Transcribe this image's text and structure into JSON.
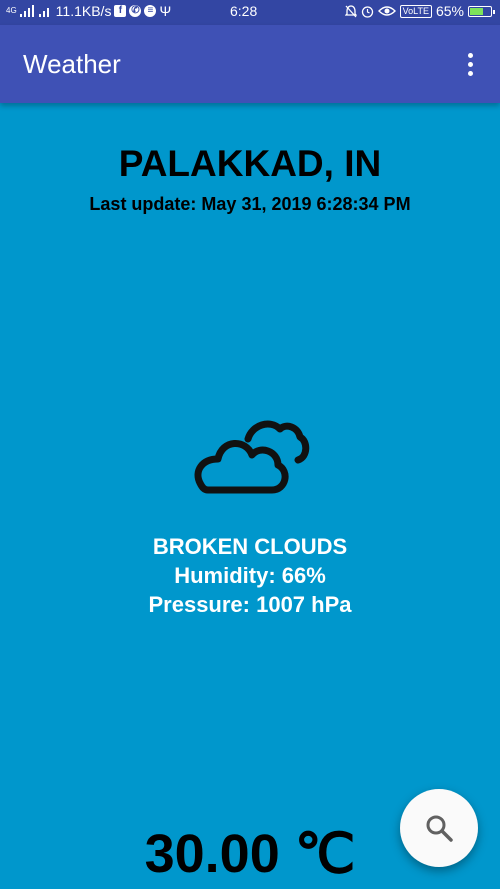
{
  "status_bar": {
    "network": "4G",
    "speed": "11.1KB/s",
    "time": "6:28",
    "volte": "VoLTE",
    "battery": "65%",
    "battery_level": 0.65
  },
  "app_bar": {
    "title": "Weather",
    "menu_icon": "more-vert-icon"
  },
  "weather": {
    "city": "PALAKKAD, IN",
    "last_update": "Last update: May 31, 2019 6:28:34 PM",
    "icon": "broken-clouds-icon",
    "description": "BROKEN CLOUDS",
    "humidity": "Humidity: 66%",
    "pressure": "Pressure: 1007 hPa",
    "temperature": "30.00 ℃"
  },
  "fab": {
    "icon": "search-icon"
  },
  "colors": {
    "status_bar": "#3346a3",
    "app_bar": "#3f51b5",
    "background": "#0097cc",
    "fab": "#fafafa"
  }
}
